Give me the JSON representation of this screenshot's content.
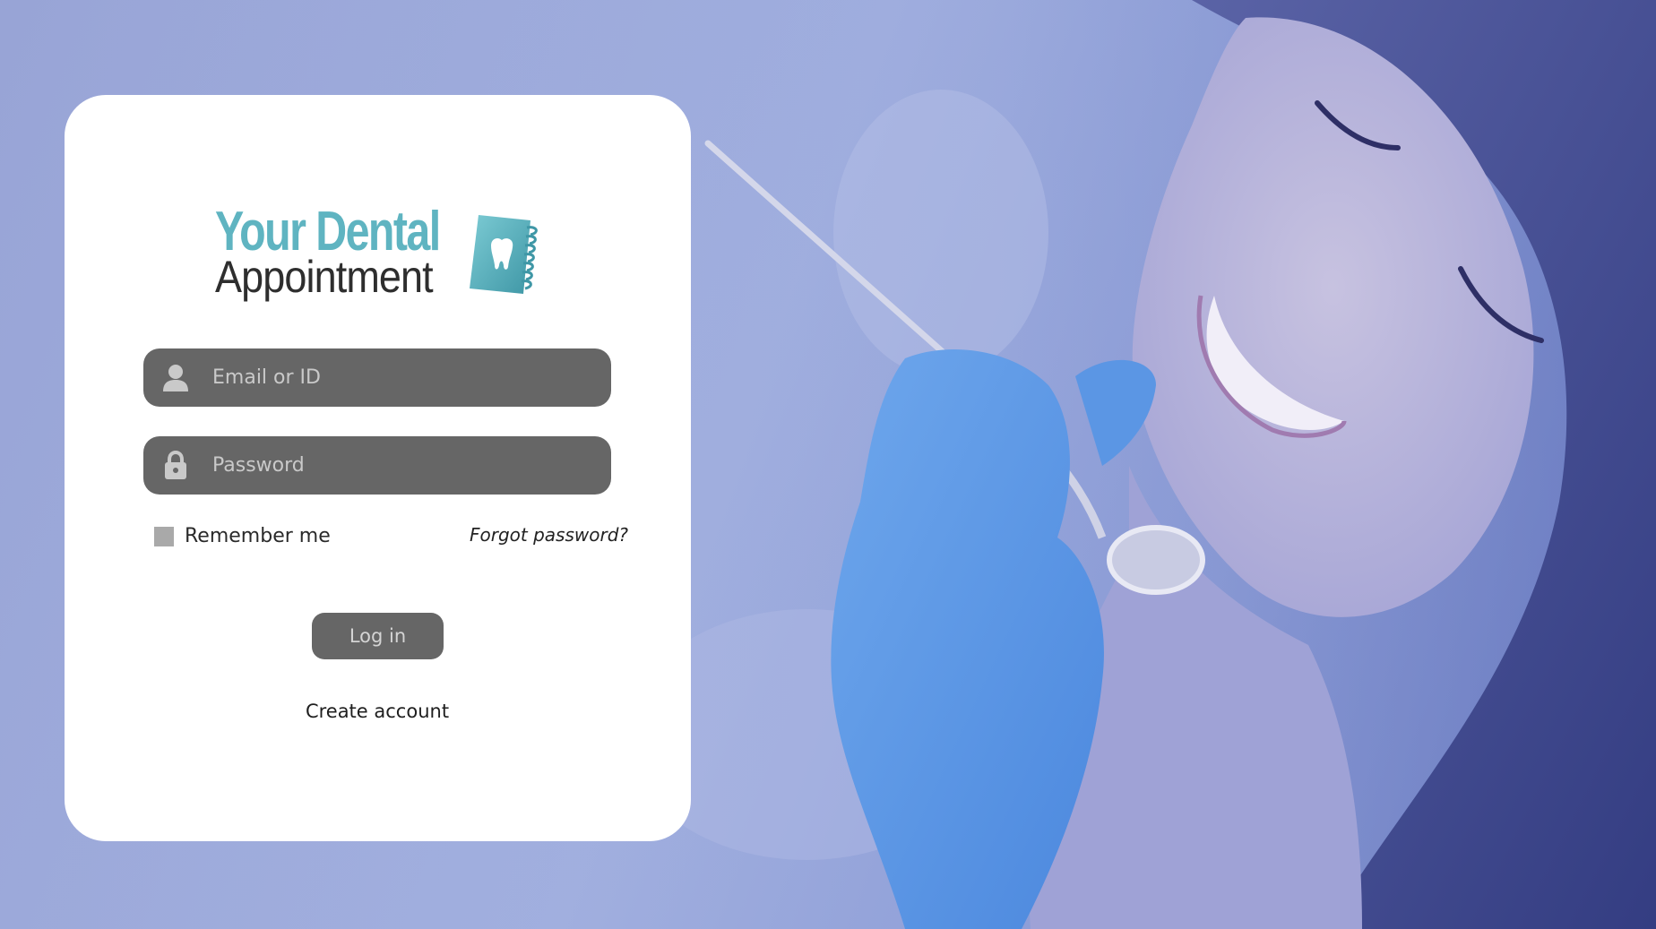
{
  "brand": {
    "line1": "Your Dental",
    "line2": "Appointment",
    "accent_color": "#5fb4c1",
    "emblem_icon": "tooth-notebook-icon"
  },
  "login_form": {
    "email_placeholder": "Email or ID",
    "email_icon": "user-icon",
    "password_placeholder": "Password",
    "password_icon": "lock-icon",
    "remember_label": "Remember me",
    "remember_checked": false,
    "forgot_label": "Forgot password?",
    "submit_label": "Log in",
    "create_account_label": "Create account"
  },
  "theme": {
    "overlay_color": "#98a4d6",
    "field_color": "#666666",
    "card_color": "#ffffff"
  }
}
